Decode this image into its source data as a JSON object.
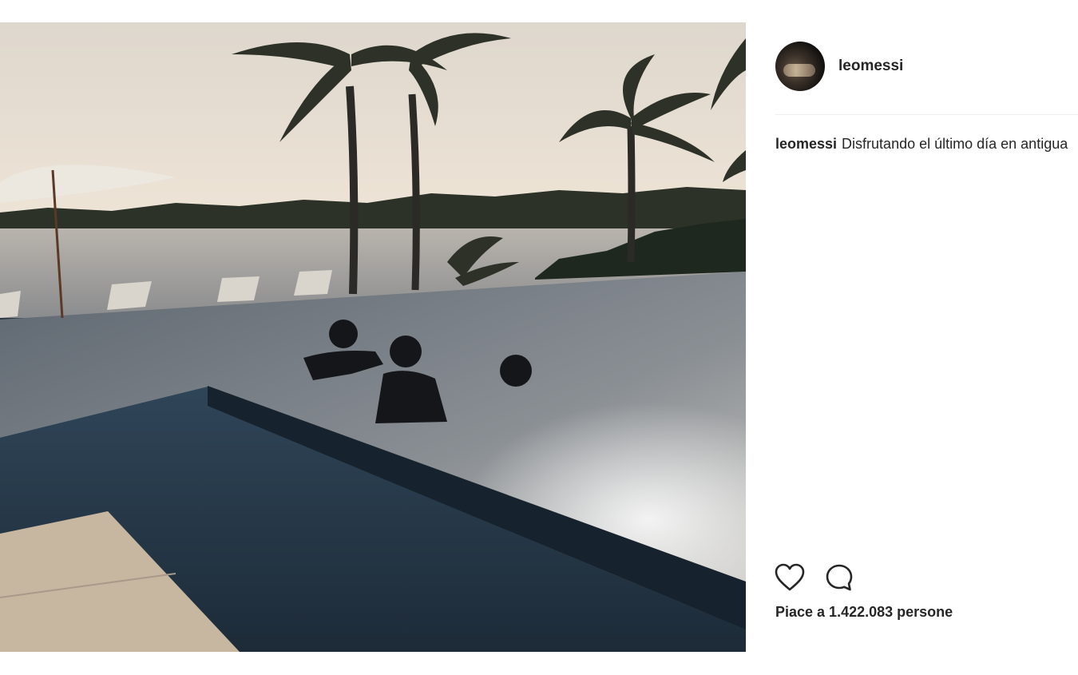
{
  "post": {
    "photo_alt": "",
    "author": {
      "username": "leomessi"
    },
    "caption": {
      "username": "leomessi",
      "text": "Disfrutando el último día en antigua"
    },
    "actions": {
      "like_icon": "heart-icon",
      "comment_icon": "comment-icon"
    },
    "likes_text": "Piace a 1.422.083 persone"
  },
  "colors": {
    "text": "#262626",
    "divider": "#efefef",
    "background": "#ffffff"
  }
}
